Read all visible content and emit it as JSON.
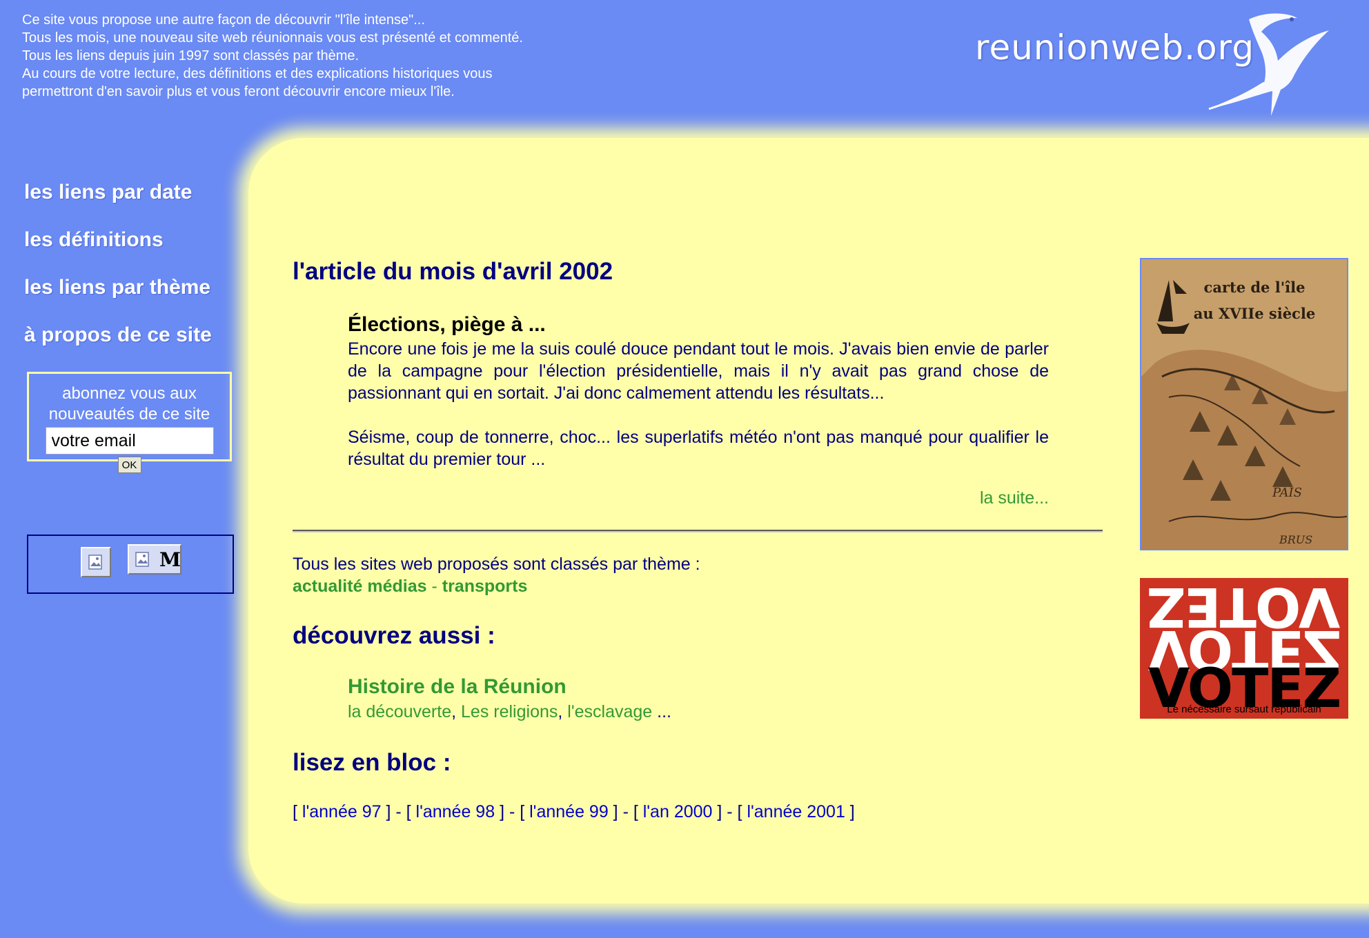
{
  "header": {
    "intro_lines": [
      "Ce site vous propose une autre façon de découvrir \"l'île intense\"...",
      "Tous les mois, une nouveau site web réunionnais vous est présenté et commenté.",
      "Tous les liens depuis juin 1997 sont classés par thème.",
      "Au cours de votre lecture, des définitions et des explications historiques vous",
      "permettront d'en savoir plus et vous feront découvrir encore mieux l'île."
    ],
    "logo_text": "reunionweb.org"
  },
  "nav": {
    "items": [
      {
        "label": "les liens par date"
      },
      {
        "label": "les définitions"
      },
      {
        "label": "les liens par thème"
      },
      {
        "label": "à propos de ce site"
      }
    ]
  },
  "subscribe": {
    "label_line1": "abonnez vous aux",
    "label_line2": "nouveautés de ce site",
    "email_value": "votre email",
    "ok_label": "OK",
    "m_label": "M"
  },
  "article": {
    "heading": "l'article du mois d'avril 2002",
    "title": "Élections, piège à ...",
    "paragraphs": [
      "Encore une fois je me la suis coulé douce pendant tout le mois. J'avais bien envie de parler de la campagne pour l'élection présidentielle, mais il n'y avait pas grand chose de passionnant qui en sortait. J'ai donc calmement attendu les résultats...",
      "Séisme, coup de tonnerre, choc... les superlatifs météo n'ont pas manqué pour qualifier le résultat du premier tour ..."
    ],
    "more_label": "la suite..."
  },
  "themes": {
    "intro": "Tous les sites web proposés sont classés par thème :",
    "links": [
      "actualité médias",
      "transports"
    ],
    "separator": " - "
  },
  "discover": {
    "heading": "découvrez aussi :",
    "title": "Histoire de la Réunion",
    "links": [
      "la découverte",
      "Les religions",
      "l'esclavage"
    ],
    "comma": ", ",
    "ellipsis": " ..."
  },
  "read": {
    "heading": "lisez en bloc :",
    "open": "[ ",
    "close": " ]",
    "between": " ] - [ ",
    "years": [
      "l'année 97",
      "l'année 98",
      "l'année 99",
      "l'an 2000",
      "l'année 2001"
    ]
  },
  "sidebar_images": {
    "map_title_line1": "carte de l'île",
    "map_title_line2": "au XVIIe siècle",
    "map_label": "PAIS",
    "map_label2": "BRUS",
    "vote_word": "VOTEZ",
    "vote_subtitle": "Le nécessaire sursaut républicain"
  },
  "colors": {
    "page_background": "#6a8af4",
    "panel_background": "#ffffaa",
    "heading_navy": "#000080",
    "link_green": "#339933",
    "link_blue": "#0000cc",
    "vote_red": "#cc3322"
  }
}
